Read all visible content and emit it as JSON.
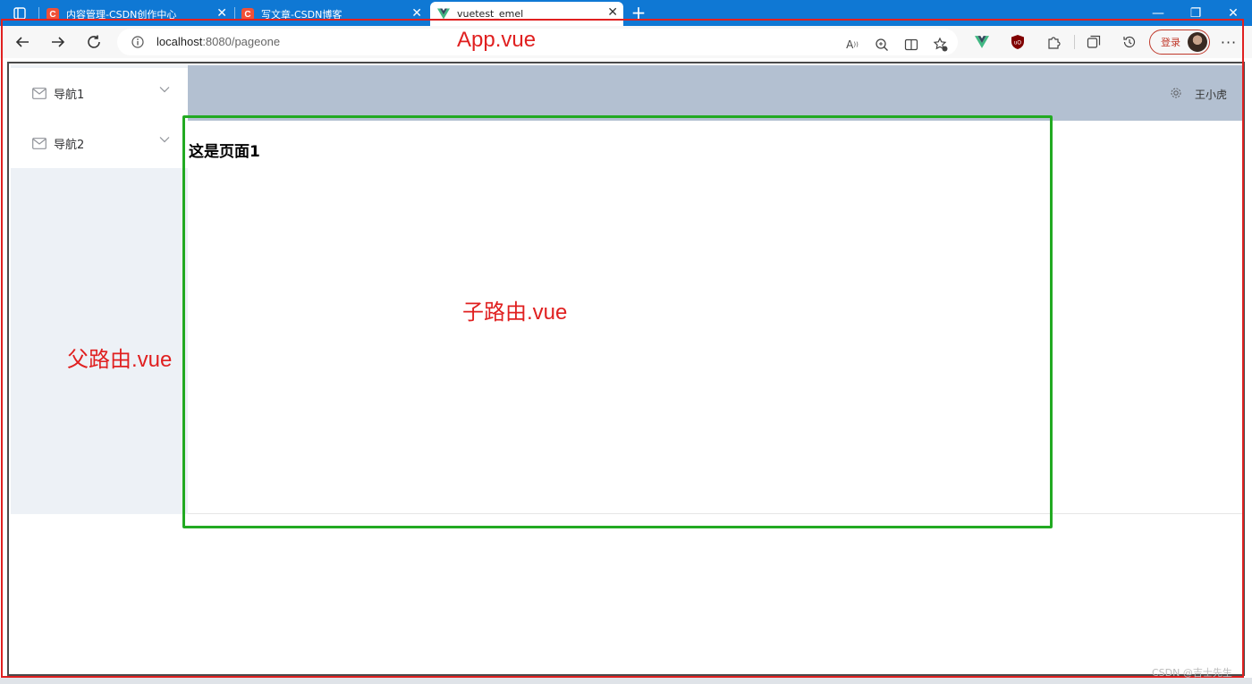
{
  "browser": {
    "tabs": [
      {
        "title": "内容管理-CSDN创作中心",
        "favicon": "C"
      },
      {
        "title": "写文章-CSDN博客",
        "favicon": "C"
      },
      {
        "title": "vuetest_emel",
        "favicon": "vue-logo"
      }
    ],
    "active_tab_index": 2,
    "address": {
      "host": "localhost",
      "path": ":8080/pageone"
    },
    "login_label": "登录",
    "accent": "#0f78d4"
  },
  "app": {
    "sidebar": {
      "items": [
        {
          "label": "导航1",
          "icon": "envelope-icon"
        },
        {
          "label": "导航2",
          "icon": "envelope-icon"
        }
      ],
      "background": "#edf1f6"
    },
    "header": {
      "username": "王小虎",
      "background": "#b3c0d1"
    },
    "main": {
      "heading": "这是页面1"
    }
  },
  "annotations": {
    "app_label": "App.vue",
    "parent_label": "父路由.vue",
    "child_label": "子路由.vue",
    "red": "#e02020",
    "green": "#22aa22"
  },
  "watermark": "CSDN @吉士先生"
}
